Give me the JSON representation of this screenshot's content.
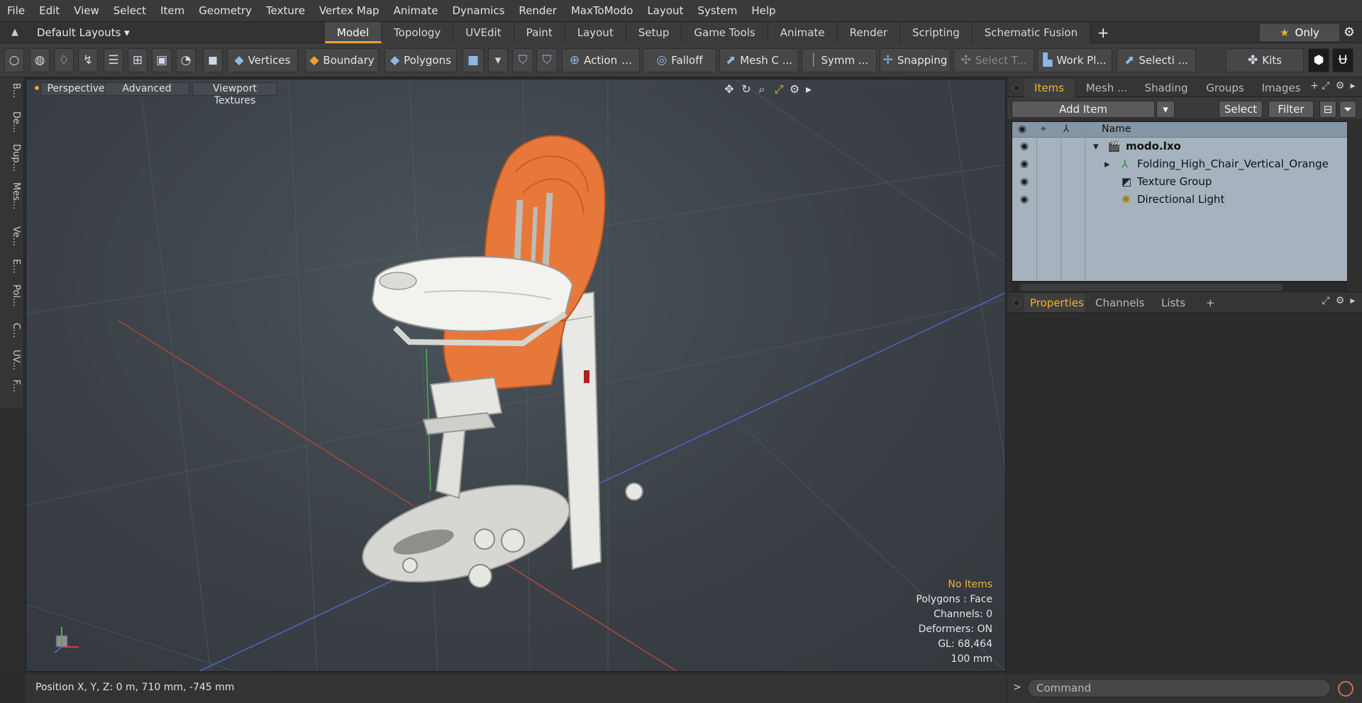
{
  "menu": [
    "File",
    "Edit",
    "View",
    "Select",
    "Item",
    "Geometry",
    "Texture",
    "Vertex Map",
    "Animate",
    "Dynamics",
    "Render",
    "MaxToModo",
    "Layout",
    "System",
    "Help"
  ],
  "layout_bar": {
    "layout_name": "Default Layouts ▾",
    "tabs": [
      "Model",
      "Topology",
      "UVEdit",
      "Paint",
      "Layout",
      "Setup",
      "Game Tools",
      "Animate",
      "Render",
      "Scripting",
      "Schematic Fusion"
    ],
    "active_tab": "Model",
    "add_tab": "+",
    "only_label": "Only"
  },
  "toolbar": {
    "vertices": "Vertices",
    "boundary": "Boundary",
    "polygons": "Polygons",
    "action": "Action",
    "falloff": "Falloff",
    "mesh_c": "Mesh C ...",
    "symm": "Symm ...",
    "snapping": "Snapping",
    "select_t": "Select T...",
    "work_pl": "Work Pl...",
    "selecti": "Selecti ...",
    "kits": "Kits"
  },
  "left_tabs": [
    "B...",
    "De...",
    "Dup...",
    "Mes...",
    "Ve...",
    "E...",
    "Pol...",
    "C...",
    "UV...",
    "F..."
  ],
  "viewport": {
    "perspective": "Perspective",
    "advanced": "Advanced",
    "textures": "Viewport Textures",
    "stats": {
      "selection": "No Items",
      "polygons": "Polygons : Face",
      "channels": "Channels: 0",
      "deformers": "Deformers: ON",
      "gl": "GL: 68,464",
      "unit": "100 mm"
    }
  },
  "status": {
    "position": "Position X, Y, Z:  0 m, 710 mm, -745 mm"
  },
  "items_panel": {
    "tabs": [
      "Items",
      "Mesh ...",
      "Shading",
      "Groups",
      "Images"
    ],
    "active_tab": "Items",
    "add_item": "Add Item",
    "select": "Select",
    "filter": "Filter",
    "name_header": "Name",
    "rows": [
      {
        "label": "modo.lxo"
      },
      {
        "label": "Folding_High_Chair_Vertical_Orange"
      },
      {
        "label": "Texture Group"
      },
      {
        "label": "Directional Light"
      }
    ]
  },
  "properties_panel": {
    "tabs": [
      "Properties",
      "Channels",
      "Lists"
    ],
    "active_tab": "Properties",
    "add": "+"
  },
  "command": {
    "placeholder": "Command"
  },
  "colors": {
    "accent": "#f0a030",
    "seat": "#e8773a",
    "plastic": "#e4e4e0"
  }
}
